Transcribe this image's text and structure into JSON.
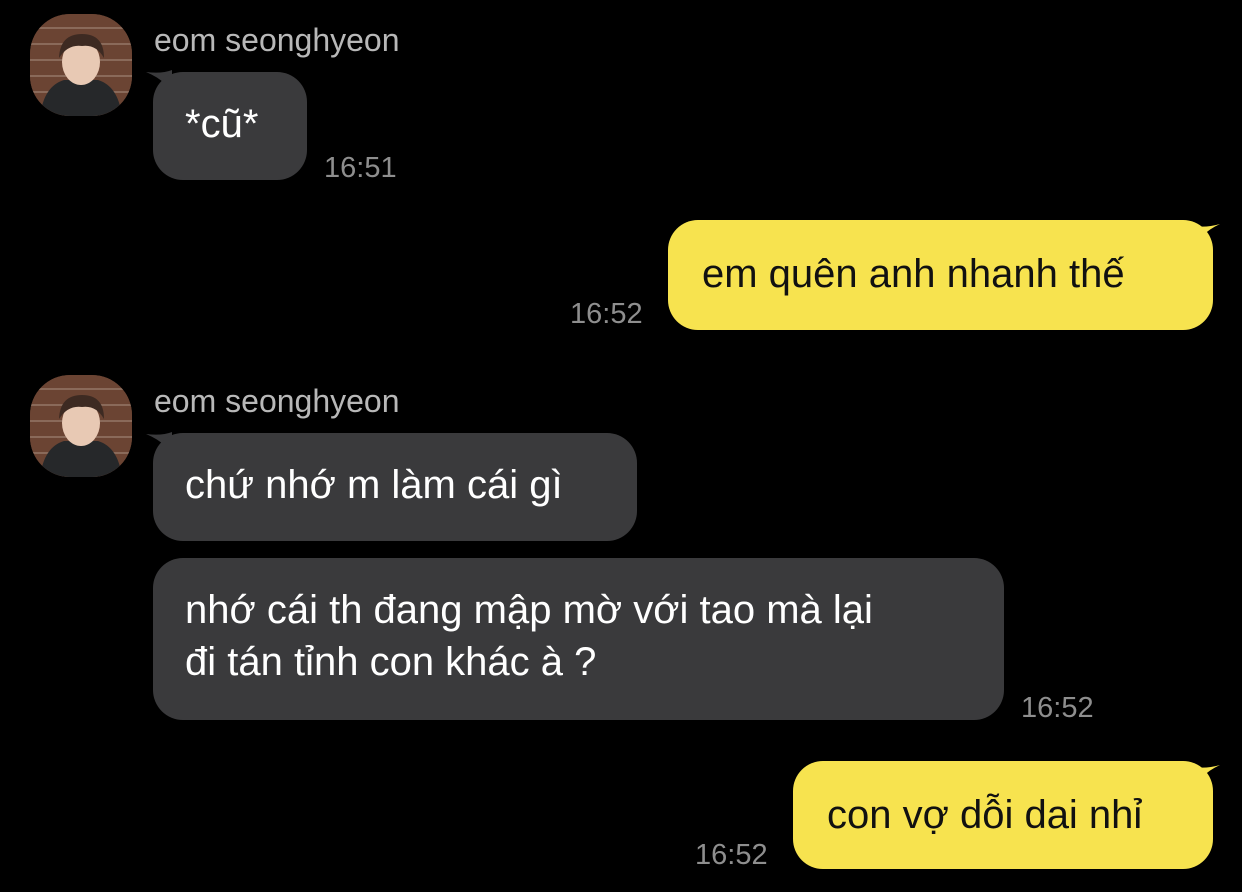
{
  "colors": {
    "background": "#000000",
    "incoming_bubble": "#3a3a3c",
    "outgoing_bubble": "#f7e34f",
    "timestamp": "#8e8e8e",
    "sender_name": "#b8b8b8"
  },
  "groups": [
    {
      "direction": "incoming",
      "sender": "eom seonghyeon",
      "messages": [
        {
          "text": "*cũ*"
        }
      ],
      "time": "16:51"
    },
    {
      "direction": "outgoing",
      "messages": [
        {
          "text": "em quên anh nhanh thế"
        }
      ],
      "time": "16:52"
    },
    {
      "direction": "incoming",
      "sender": "eom seonghyeon",
      "messages": [
        {
          "text": "chứ nhớ m làm cái gì"
        },
        {
          "lines": [
            "nhớ cái th đang mập mờ với tao mà lại",
            "đi tán tỉnh con khác à ?"
          ]
        }
      ],
      "time": "16:52"
    },
    {
      "direction": "outgoing",
      "messages": [
        {
          "text": "con vợ dỗi dai nhỉ"
        }
      ],
      "time": "16:52"
    }
  ]
}
